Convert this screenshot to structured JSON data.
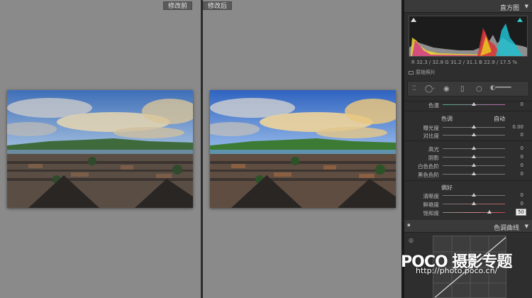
{
  "views": {
    "before_label": "修改前",
    "after_label": "修改后"
  },
  "histogram": {
    "title": "直方图",
    "rgb_readout": "R 32.3 / 32.8   G 31.2 / 31.1   B 22.9 / 17.5 %",
    "original_photo": "原始照片"
  },
  "basic": {
    "hue_label": "色温",
    "hue_value": "0",
    "tone_group": "色调",
    "auto_label": "自动",
    "sliders_tone": [
      {
        "label": "曝光度",
        "value": "0.00",
        "pos": 0.5
      },
      {
        "label": "对比度",
        "value": "0",
        "pos": 0.5
      }
    ],
    "sliders_light": [
      {
        "label": "高光",
        "value": "0",
        "pos": 0.5
      },
      {
        "label": "阴影",
        "value": "0",
        "pos": 0.5
      },
      {
        "label": "白色色阶",
        "value": "0",
        "pos": 0.5
      },
      {
        "label": "黑色色阶",
        "value": "0",
        "pos": 0.5
      }
    ],
    "presence_group": "偏好",
    "sliders_presence": [
      {
        "label": "清晰度",
        "value": "0",
        "pos": 0.5
      },
      {
        "label": "鲜艳度",
        "value": "0",
        "pos": 0.5
      },
      {
        "label": "饱和度",
        "value": "50",
        "pos": 0.75
      }
    ]
  },
  "tone_curve": {
    "title": "色调曲线"
  },
  "watermark": {
    "brand": "POCO 摄影专题",
    "url": "http://photo.poco.cn/"
  },
  "colors": {
    "accent": "#cfcfcf",
    "panel": "#2e2e2e",
    "canvas": "#8a8a8a"
  }
}
